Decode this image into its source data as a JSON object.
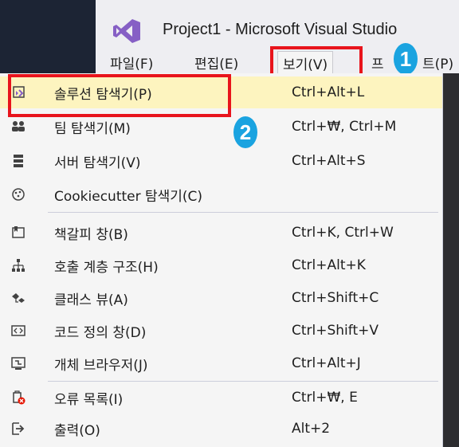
{
  "window": {
    "title": "Project1 - Microsoft Visual Studio"
  },
  "menubar": {
    "items": [
      {
        "label": "파일(F)"
      },
      {
        "label": "편집(E)"
      },
      {
        "label": "보기(V)"
      },
      {
        "label": "프로젝트(P)"
      }
    ],
    "partial_label": "프",
    "partial_label_end": "트(P)"
  },
  "annotations": {
    "step1": "1",
    "step2": "2",
    "highlight_color": "#e8141c",
    "badge_color": "#1aa3e0"
  },
  "view_menu": {
    "items": [
      {
        "label": "솔루션 탐색기(P)",
        "shortcut": "Ctrl+Alt+L",
        "icon": "solution-explorer-icon",
        "selected": true
      },
      {
        "label": "팀 탐색기(M)",
        "shortcut": "Ctrl+₩, Ctrl+M",
        "icon": "team-explorer-icon"
      },
      {
        "label": "서버 탐색기(V)",
        "shortcut": "Ctrl+Alt+S",
        "icon": "server-explorer-icon"
      },
      {
        "label": "Cookiecutter 탐색기(C)",
        "shortcut": "",
        "icon": "cookiecutter-icon"
      },
      {
        "label": "책갈피 창(B)",
        "shortcut": "Ctrl+K, Ctrl+W",
        "icon": "bookmark-window-icon"
      },
      {
        "label": "호출 계층 구조(H)",
        "shortcut": "Ctrl+Alt+K",
        "icon": "call-hierarchy-icon"
      },
      {
        "label": "클래스 뷰(A)",
        "shortcut": "Ctrl+Shift+C",
        "icon": "class-view-icon"
      },
      {
        "label": "코드 정의 창(D)",
        "shortcut": "Ctrl+Shift+V",
        "icon": "code-definition-icon"
      },
      {
        "label": "개체 브라우저(J)",
        "shortcut": "Ctrl+Alt+J",
        "icon": "object-browser-icon"
      },
      {
        "label": "오류 목록(I)",
        "shortcut": "Ctrl+₩, E",
        "icon": "error-list-icon"
      },
      {
        "label": "출력(O)",
        "shortcut": "Alt+2",
        "icon": "output-icon"
      }
    ]
  }
}
